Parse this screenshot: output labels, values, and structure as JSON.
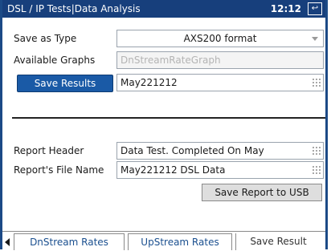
{
  "titlebar": {
    "title": "DSL / IP Tests|Data Analysis",
    "clock": "12:12",
    "exit_icon": "exit-icon"
  },
  "form": {
    "save_as_type_label": "Save as Type",
    "save_as_type_value": "AXS200 format",
    "available_graphs_label": "Available Graphs",
    "available_graphs_value": "DnStreamRateGraph",
    "save_results_button": "Save Results",
    "save_results_value": "May221212"
  },
  "report": {
    "header_label": "Report Header",
    "header_value": "Data Test. Completed On May",
    "filename_label": "Report's File Name",
    "filename_value": "May221212 DSL Data",
    "save_usb_button": "Save Report to USB"
  },
  "tabs": [
    {
      "label": "DnStream Rates"
    },
    {
      "label": "UpStream Rates"
    },
    {
      "label": "Save Result"
    }
  ]
}
